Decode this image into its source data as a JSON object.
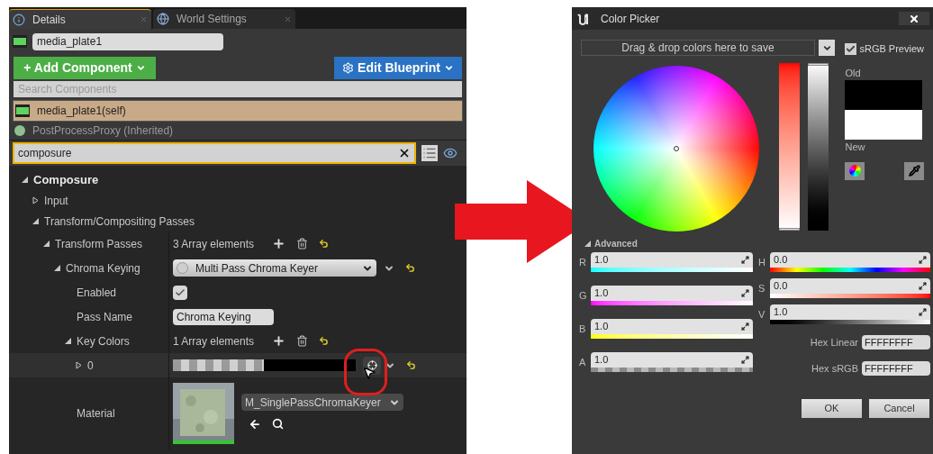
{
  "details_panel": {
    "tabs": [
      {
        "label": "Details",
        "selected": true
      },
      {
        "label": "World Settings",
        "selected": false
      }
    ],
    "actor_name": "media_plate1",
    "add_component_button": "+ Add Component",
    "edit_blueprint_button": "Edit Blueprint",
    "component_search": {
      "placeholder": "Search Components"
    },
    "components": [
      {
        "label": "media_plate1(self)",
        "selected": true
      },
      {
        "label": "PostProcessProxy (Inherited)",
        "selected": false
      }
    ],
    "property_search": {
      "value": "composure"
    },
    "properties": [
      {
        "kind": "category",
        "label": "Composure",
        "expanded": true,
        "children": [
          {
            "kind": "group",
            "label": "Input",
            "expanded": false
          },
          {
            "kind": "group",
            "label": "Transform/Compositing Passes",
            "expanded": true,
            "children": [
              {
                "kind": "array",
                "label": "Transform Passes",
                "expanded": true,
                "value": "3 Array elements",
                "children": [
                  {
                    "kind": "dropdown",
                    "label": "Chroma Keying",
                    "expanded": true,
                    "value": "Multi Pass Chroma Keyer",
                    "children": [
                      {
                        "kind": "checkbox",
                        "label": "Enabled",
                        "checked": true
                      },
                      {
                        "kind": "text",
                        "label": "Pass Name",
                        "value": "Chroma Keying"
                      },
                      {
                        "kind": "array",
                        "label": "Key Colors",
                        "expanded": true,
                        "value": "1 Array elements",
                        "children": [
                          {
                            "kind": "color",
                            "label": "0",
                            "expanded": false,
                            "color": "#000000"
                          }
                        ]
                      },
                      {
                        "kind": "material",
                        "label": "Material",
                        "value": "M_SinglePassChromaKeyer"
                      }
                    ]
                  }
                ]
              }
            ]
          }
        ]
      }
    ]
  },
  "color_picker": {
    "title": "Color Picker",
    "themes_dropdown": "Drag & drop colors here to save",
    "saturation_slider": {
      "level": 0
    },
    "value_slider": {
      "level": 1
    },
    "srgb_preview": {
      "label": "sRGB Preview",
      "checked": true
    },
    "old": {
      "label": "Old",
      "color": "#000000"
    },
    "new": {
      "label": "New",
      "color": "#ffffff"
    },
    "advanced": {
      "label": "Advanced",
      "expanded": true
    },
    "rgba": [
      {
        "name": "R",
        "value": "1.0"
      },
      {
        "name": "G",
        "value": "1.0"
      },
      {
        "name": "B",
        "value": "1.0"
      },
      {
        "name": "A",
        "value": "1.0"
      }
    ],
    "hsv": [
      {
        "name": "H",
        "value": "0.0"
      },
      {
        "name": "S",
        "value": "0.0"
      },
      {
        "name": "V",
        "value": "1.0"
      }
    ],
    "hex": [
      {
        "label": "Hex Linear",
        "value": "FFFFFFFF"
      },
      {
        "label": "Hex sRGB",
        "value": "FFFFFFFF"
      }
    ],
    "buttons": [
      "OK",
      "Cancel"
    ]
  }
}
